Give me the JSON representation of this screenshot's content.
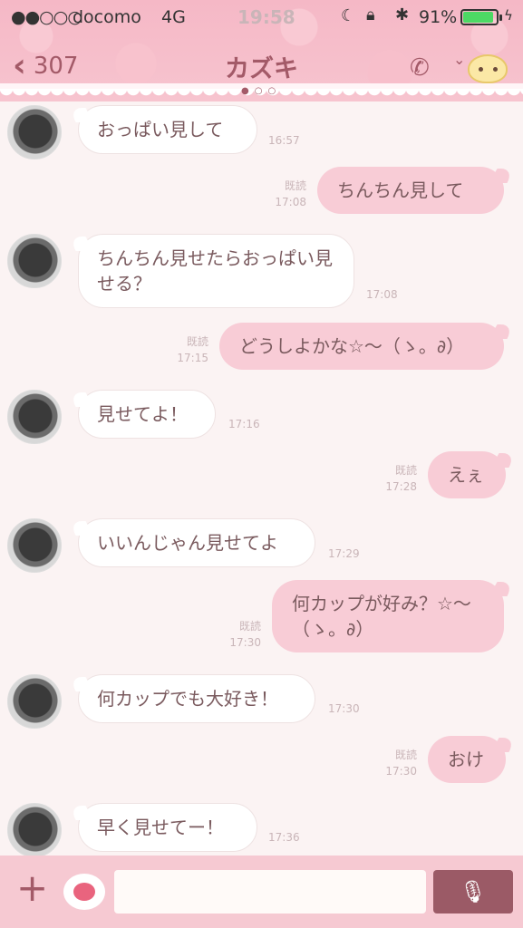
{
  "status": {
    "signal": "●●○○○",
    "carrier": "docomo",
    "network": "4G",
    "time": "19:58",
    "battery": "91%",
    "battery_level": 0.91
  },
  "header": {
    "back_count": "307",
    "title": "カズキ",
    "back_icon": "chevron-left-icon",
    "call_icon": "phone-icon",
    "menu_icon": "chevron-down-icon"
  },
  "messages": [
    {
      "dir": "in",
      "text": "おっぱい見して",
      "time": "16:57"
    },
    {
      "dir": "out",
      "text": "ちんちん見して",
      "read": "既読",
      "time": "17:08"
    },
    {
      "dir": "in",
      "text": "ちんちん見せたらおっぱい見せる？",
      "time": "17:08"
    },
    {
      "dir": "out",
      "text": "どうしよかな☆〜（ゝ。∂）",
      "read": "既読",
      "time": "17:15"
    },
    {
      "dir": "in",
      "text": "見せてよ！",
      "time": "17:16"
    },
    {
      "dir": "out",
      "text": "えぇ",
      "read": "既読",
      "time": "17:28"
    },
    {
      "dir": "in",
      "text": "いいんじゃん見せてよ",
      "time": "17:29"
    },
    {
      "dir": "out",
      "text": "何カップが好み？☆〜（ゝ。∂）",
      "read": "既読",
      "time": "17:30"
    },
    {
      "dir": "in",
      "text": "何カップでも大好き！",
      "time": "17:30"
    },
    {
      "dir": "out",
      "text": "おけ",
      "read": "既読",
      "time": "17:30"
    },
    {
      "dir": "in",
      "text": "早く見せてー！",
      "time": "17:36"
    }
  ],
  "composer": {
    "plus_icon": "plus-icon",
    "sticker_icon": "sticker-icon",
    "mic_icon": "microphone-icon"
  }
}
